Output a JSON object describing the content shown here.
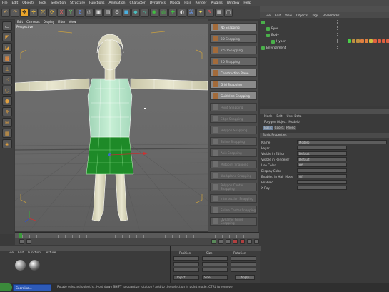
{
  "menubar": [
    "File",
    "Edit",
    "Objects",
    "Tools",
    "Selection",
    "Structure",
    "Functions",
    "Animation",
    "Character",
    "Dynamics",
    "Mocca",
    "Hair",
    "Render",
    "Plugins",
    "Window",
    "Help"
  ],
  "viewport": {
    "menu": [
      "Edit",
      "Cameras",
      "Display",
      "Filter",
      "View"
    ],
    "label": "Perspective"
  },
  "snap_menu": [
    {
      "label": "No Snapping",
      "state": "on"
    },
    {
      "label": "3D Snapping",
      "state": "normal"
    },
    {
      "label": "2.5D Snapping",
      "state": "normal"
    },
    {
      "label": "2D Snapping",
      "state": "normal"
    },
    {
      "label": "Construction Plane",
      "state": "on"
    },
    {
      "label": "Grid Snapping",
      "state": "on"
    },
    {
      "label": "Guideline Snapping",
      "state": "on"
    },
    {
      "label": "Point Snapping",
      "state": "dis"
    },
    {
      "label": "Edge Snapping",
      "state": "dis"
    },
    {
      "label": "Polygon Snapping",
      "state": "dis"
    },
    {
      "label": "Spline Snapping",
      "state": "dis"
    },
    {
      "label": "Axis Snapping",
      "state": "dis"
    },
    {
      "label": "Midpoint Snapping",
      "state": "dis"
    },
    {
      "label": "Workplane Snapping",
      "state": "dis"
    },
    {
      "label": "Polygon Center Snapping",
      "state": "dis"
    },
    {
      "label": "Intersection Snapping",
      "state": "dis"
    },
    {
      "label": "Spline Center Snapping",
      "state": "dis"
    },
    {
      "label": "Dynamic Guide Snapping",
      "state": "dis"
    }
  ],
  "object_manager": {
    "menu": [
      "File",
      "Edit",
      "View",
      "Objects",
      "Tags",
      "Bookmarks"
    ],
    "rows": [
      {
        "name": "",
        "indent": 0
      },
      {
        "name": "Eyes",
        "indent": 1
      },
      {
        "name": "Body",
        "indent": 1
      },
      {
        "name": "Hyper",
        "indent": 2
      },
      {
        "name": "Environment",
        "indent": 0
      }
    ]
  },
  "attributes": {
    "menu": [
      "Mode",
      "Edit",
      "User Data"
    ],
    "object_title": "Polygon Object [Modelo]",
    "tabs": [
      "Basic",
      "Coord.",
      "Phong"
    ],
    "section_title": "Basic Properties",
    "fields": [
      {
        "label": "Name",
        "value": "Modelo"
      },
      {
        "label": "Layer",
        "value": ""
      },
      {
        "label": "Visible in Editor",
        "value": "Default"
      },
      {
        "label": "Visible in Renderer",
        "value": "Default"
      },
      {
        "label": "Use Color",
        "value": "Off"
      },
      {
        "label": "Display Color",
        "value": ""
      },
      {
        "label": "Enabled in Hair Mode",
        "value": "Off"
      },
      {
        "label": "Enabled",
        "value": ""
      },
      {
        "label": "X-Ray",
        "value": ""
      }
    ]
  },
  "material_manager": {
    "menu": [
      "File",
      "Edit",
      "Function",
      "Texture"
    ]
  },
  "coordinates": {
    "headers": [
      "Position",
      "Size",
      "Rotation"
    ],
    "button": "Apply",
    "dropdowns": [
      "Object",
      "Size"
    ]
  },
  "statusbar": {
    "task_button": "Coordina...",
    "text": "Rotate selected object(s). Hold down SHIFT to quantize rotation / add to the selection in point mode, CTRL to remove."
  }
}
